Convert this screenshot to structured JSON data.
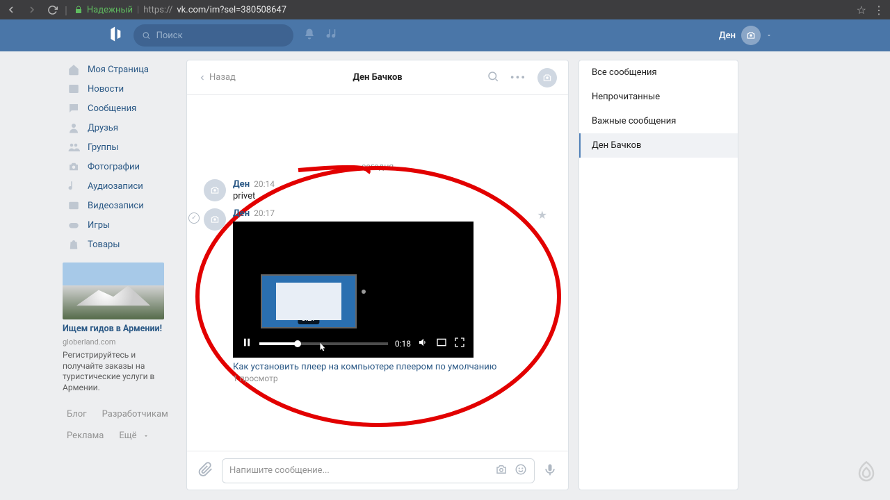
{
  "browser": {
    "secure_label": "Надежный",
    "url_prefix": "https://",
    "url": "vk.com/im?sel=380508647"
  },
  "topbar": {
    "search_placeholder": "Поиск",
    "user_name": "Ден"
  },
  "nav": {
    "items": [
      {
        "label": "Моя Страница"
      },
      {
        "label": "Новости"
      },
      {
        "label": "Сообщения"
      },
      {
        "label": "Друзья"
      },
      {
        "label": "Группы"
      },
      {
        "label": "Фотографии"
      },
      {
        "label": "Аудиозаписи"
      },
      {
        "label": "Видеозаписи"
      },
      {
        "label": "Игры"
      },
      {
        "label": "Товары"
      }
    ]
  },
  "ad": {
    "title": "Ищем гидов в Армении!",
    "domain": "globerland.com",
    "text": "Регистрируйтесь и получайте заказы на туристические услуги в Армении."
  },
  "footer": {
    "blog": "Блог",
    "devs": "Разработчикам",
    "ads": "Реклама",
    "more": "Ещё"
  },
  "chat": {
    "back": "Назад",
    "title": "Ден Бачков",
    "date": "сегодня",
    "m1": {
      "name": "Ден",
      "time": "20:14",
      "text": "privet"
    },
    "m2": {
      "name": "Ден",
      "time": "20:17"
    },
    "video": {
      "thumb_time": "0:27",
      "current_time": "0:18",
      "title": "Как установить плеер на компьютере плеером по умолчанию",
      "views": "1 просмотр"
    },
    "compose_placeholder": "Напишите сообщение..."
  },
  "right": {
    "all": "Все сообщения",
    "unread": "Непрочитанные",
    "important": "Важные сообщения",
    "active": "Ден Бачков"
  }
}
